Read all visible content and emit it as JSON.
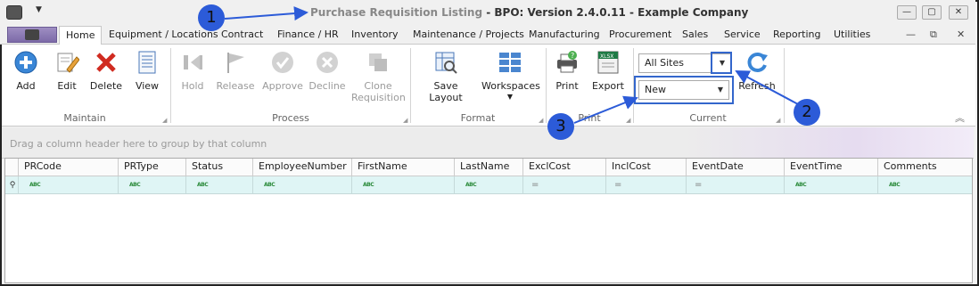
{
  "window": {
    "title": "Purchase Requisition Listing",
    "title_suffix": " - BPO: Version 2.4.0.11 - Example Company",
    "controls": [
      "—",
      "▢",
      "✕"
    ],
    "mdi_controls": [
      "—",
      "⧉",
      "✕"
    ]
  },
  "tabs": [
    "Home",
    "Equipment / Locations",
    "Contract",
    "Finance / HR",
    "Inventory",
    "Maintenance / Projects",
    "Manufacturing",
    "Procurement",
    "Sales",
    "Service",
    "Reporting",
    "Utilities"
  ],
  "ribbon": {
    "maintain": {
      "label": "Maintain",
      "buttons": [
        "Add",
        "Edit",
        "Delete",
        "View"
      ]
    },
    "process": {
      "label": "Process",
      "buttons": [
        "Hold",
        "Release",
        "Approve",
        "Decline",
        "Clone",
        "Requisition"
      ]
    },
    "format": {
      "label": "Format",
      "buttons": [
        "Save Layout",
        "Workspaces"
      ]
    },
    "print": {
      "label": "Print",
      "buttons": [
        "Print",
        "Export"
      ],
      "export_badge": "XLSX"
    },
    "current": {
      "label": "Current",
      "site_value": "All Sites",
      "status_value": "New",
      "refresh_label": "Refresh"
    }
  },
  "grid": {
    "group_hint": "Drag a column header here to group by that column",
    "columns": [
      "PRCode",
      "PRType",
      "Status",
      "EmployeeNumber",
      "FirstName",
      "LastName",
      "ExclCost",
      "InclCost",
      "EventDate",
      "EventTime",
      "Comments"
    ],
    "filter_glyphs": [
      "ABC",
      "ABC",
      "ABC",
      "ABC",
      "ABC",
      "ABC",
      "=",
      "=",
      "=",
      "ABC",
      "ABC"
    ]
  },
  "annotations": [
    "1",
    "2",
    "3"
  ],
  "colors": {
    "annotation": "#2c5bd8",
    "highlight": "#3366cc",
    "filter_row": "#dff5f5"
  }
}
